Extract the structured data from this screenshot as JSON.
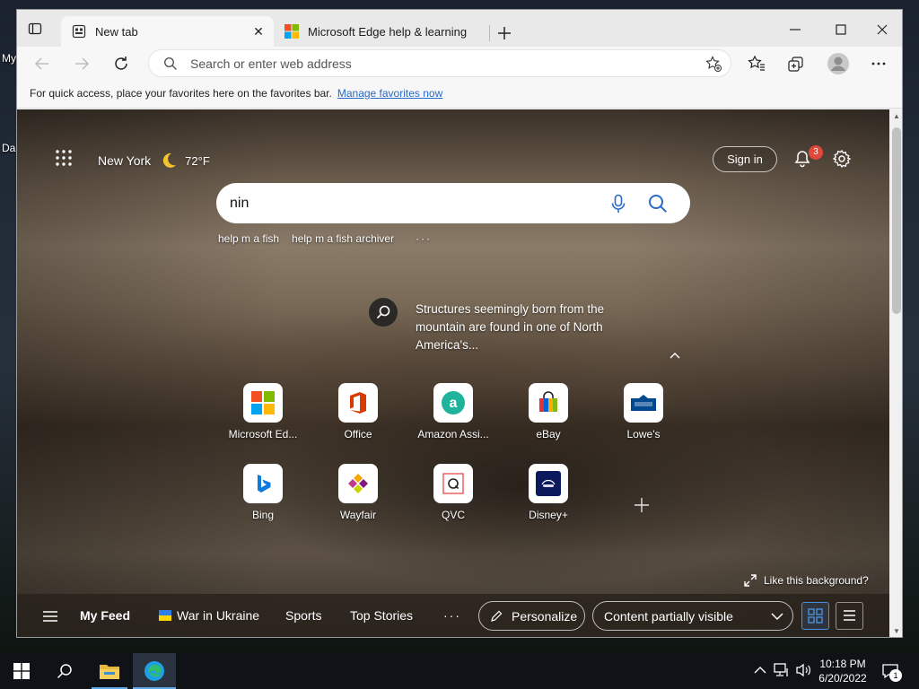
{
  "desktop": {
    "label_1": "My",
    "label_2": "Da"
  },
  "tabs": [
    {
      "label": "New tab",
      "active": true
    },
    {
      "label": "Microsoft Edge help & learning",
      "active": false
    }
  ],
  "toolbar": {
    "address_placeholder": "Search or enter web address"
  },
  "favorites_bar": {
    "message": "For quick access, place your favorites here on the favorites bar.",
    "link": "Manage favorites now"
  },
  "newtab": {
    "location": "New York",
    "temperature": "72°F",
    "sign_in": "Sign in",
    "notification_count": "3",
    "search": {
      "value": "nin"
    },
    "suggestions": [
      "help m a fish",
      "help m a fish archiver"
    ],
    "more": "···",
    "fact": "Structures seemingly born from the mountain are found in one of North America's...",
    "quick_links": [
      {
        "label": "Microsoft Ed...",
        "icon": "microsoft-logo-icon"
      },
      {
        "label": "Office",
        "icon": "office-icon"
      },
      {
        "label": "Amazon Assi...",
        "icon": "amazon-assistant-icon"
      },
      {
        "label": "eBay",
        "icon": "ebay-icon"
      },
      {
        "label": "Lowe's",
        "icon": "lowes-icon"
      },
      {
        "label": "Bing",
        "icon": "bing-icon"
      },
      {
        "label": "Wayfair",
        "icon": "wayfair-icon"
      },
      {
        "label": "QVC",
        "icon": "qvc-icon"
      },
      {
        "label": "Disney+",
        "icon": "disney-plus-icon"
      }
    ],
    "like_background": "Like this background?",
    "feed": {
      "my_feed": "My Feed",
      "items": [
        "War in Ukraine",
        "Sports",
        "Top Stories"
      ],
      "more": "···",
      "personalize": "Personalize",
      "content_visibility": "Content partially visible"
    }
  },
  "taskbar": {
    "time": "10:18 PM",
    "date": "6/20/2022",
    "notifications": "1"
  },
  "colors": {
    "accent": "#4a90e2",
    "badge": "#e0483a",
    "taskbar": "#0f1217"
  }
}
